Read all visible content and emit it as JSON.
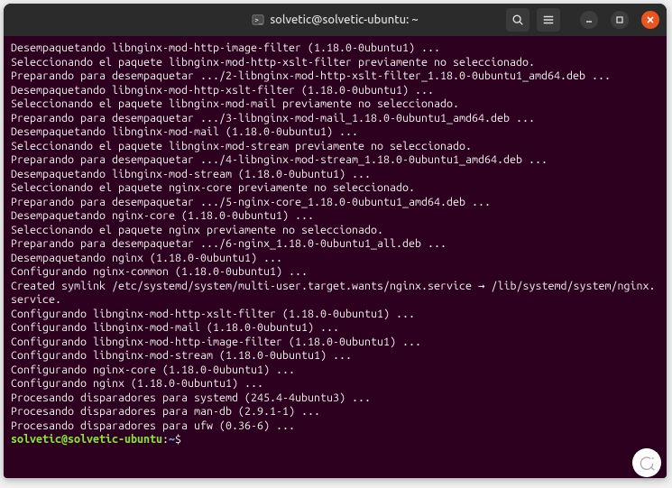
{
  "window": {
    "title": "solvetic@solvetic-ubuntu: ~"
  },
  "terminal": {
    "lines": [
      "Desempaquetando libnginx-mod-http-image-filter (1.18.0-0ubuntu1) ...",
      "Seleccionando el paquete libnginx-mod-http-xslt-filter previamente no seleccionado.",
      "Preparando para desempaquetar .../2-libnginx-mod-http-xslt-filter_1.18.0-0ubuntu1_amd64.deb ...",
      "Desempaquetando libnginx-mod-http-xslt-filter (1.18.0-0ubuntu1) ...",
      "Seleccionando el paquete libnginx-mod-mail previamente no seleccionado.",
      "Preparando para desempaquetar .../3-libnginx-mod-mail_1.18.0-0ubuntu1_amd64.deb ...",
      "Desempaquetando libnginx-mod-mail (1.18.0-0ubuntu1) ...",
      "Seleccionando el paquete libnginx-mod-stream previamente no seleccionado.",
      "Preparando para desempaquetar .../4-libnginx-mod-stream_1.18.0-0ubuntu1_amd64.deb ...",
      "Desempaquetando libnginx-mod-stream (1.18.0-0ubuntu1) ...",
      "Seleccionando el paquete nginx-core previamente no seleccionado.",
      "Preparando para desempaquetar .../5-nginx-core_1.18.0-0ubuntu1_amd64.deb ...",
      "Desempaquetando nginx-core (1.18.0-0ubuntu1) ...",
      "Seleccionando el paquete nginx previamente no seleccionado.",
      "Preparando para desempaquetar .../6-nginx_1.18.0-0ubuntu1_all.deb ...",
      "Desempaquetando nginx (1.18.0-0ubuntu1) ...",
      "Configurando nginx-common (1.18.0-0ubuntu1) ...",
      "Created symlink /etc/systemd/system/multi-user.target.wants/nginx.service → /lib/systemd/system/nginx.service.",
      "Configurando libnginx-mod-http-xslt-filter (1.18.0-0ubuntu1) ...",
      "Configurando libnginx-mod-mail (1.18.0-0ubuntu1) ...",
      "Configurando libnginx-mod-http-image-filter (1.18.0-0ubuntu1) ...",
      "Configurando libnginx-mod-stream (1.18.0-0ubuntu1) ...",
      "Configurando nginx-core (1.18.0-0ubuntu1) ...",
      "Configurando nginx (1.18.0-0ubuntu1) ...",
      "Procesando disparadores para systemd (245.4-4ubuntu3) ...",
      "Procesando disparadores para man-db (2.9.1-1) ...",
      "Procesando disparadores para ufw (0.36-6) ..."
    ],
    "prompt": {
      "user_host": "solvetic@solvetic-ubuntu",
      "separator": ":",
      "path": "~",
      "symbol": "$"
    }
  }
}
